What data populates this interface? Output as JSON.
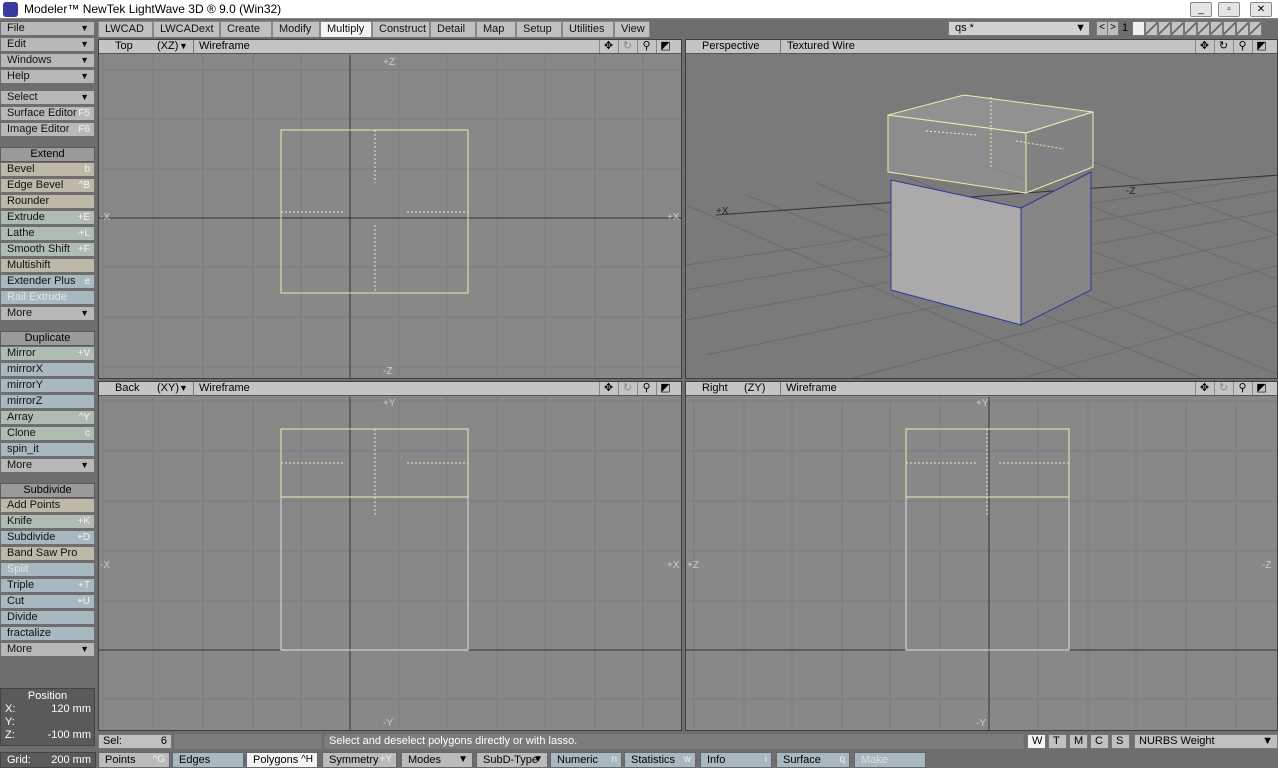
{
  "window": {
    "title": "Modeler™ NewTek LightWave 3D ® 9.0 (Win32)"
  },
  "menu_tabs": [
    "LWCAD",
    "LWCADext",
    "Create",
    "Modify",
    "Multiply",
    "Construct",
    "Detail",
    "Map",
    "Setup",
    "Utilities",
    "View"
  ],
  "active_tab": "Multiply",
  "quick_select": {
    "value": "qs *"
  },
  "layer_page": "1",
  "sidebar": {
    "top": [
      {
        "label": "File"
      },
      {
        "label": "Edit"
      },
      {
        "label": "Windows"
      },
      {
        "label": "Help"
      }
    ],
    "select": {
      "label": "Select"
    },
    "surface_editor": {
      "label": "Surface Editor",
      "key": "F5"
    },
    "image_editor": {
      "label": "Image Editor",
      "key": "F6"
    },
    "extend": {
      "header": "Extend",
      "items": [
        {
          "label": "Bevel",
          "key": "b"
        },
        {
          "label": "Edge Bevel",
          "key": "^B"
        },
        {
          "label": "Rounder",
          "key": ""
        },
        {
          "label": "Extrude",
          "key": "+E"
        },
        {
          "label": "Lathe",
          "key": "+L"
        },
        {
          "label": "Smooth Shift",
          "key": "+F"
        },
        {
          "label": "Multishift",
          "key": ""
        },
        {
          "label": "Extender Plus",
          "key": "e"
        },
        {
          "label": "Rail Extrude",
          "key": ""
        },
        {
          "label": "More",
          "key": ""
        }
      ]
    },
    "duplicate": {
      "header": "Duplicate",
      "items": [
        {
          "label": "Mirror",
          "key": "+V"
        },
        {
          "label": "mirrorX",
          "key": ""
        },
        {
          "label": "mirrorY",
          "key": ""
        },
        {
          "label": "mirrorZ",
          "key": ""
        },
        {
          "label": "Array",
          "key": "^Y"
        },
        {
          "label": "Clone",
          "key": "c"
        },
        {
          "label": "spin_it",
          "key": ""
        },
        {
          "label": "More",
          "key": ""
        }
      ]
    },
    "subdivide": {
      "header": "Subdivide",
      "items": [
        {
          "label": "Add Points",
          "key": ""
        },
        {
          "label": "Knife",
          "key": "+K"
        },
        {
          "label": "Subdivide",
          "key": "+D"
        },
        {
          "label": "Band Saw Pro",
          "key": ""
        },
        {
          "label": "Split",
          "key": ""
        },
        {
          "label": "Triple",
          "key": "+T"
        },
        {
          "label": "Cut",
          "key": "+U"
        },
        {
          "label": "Divide",
          "key": ""
        },
        {
          "label": "fractalize",
          "key": ""
        },
        {
          "label": "More",
          "key": ""
        }
      ]
    },
    "position": {
      "title": "Position",
      "x": "120 mm",
      "y": "",
      "z": "-100 mm",
      "x_lbl": "X:",
      "y_lbl": "Y:",
      "z_lbl": "Z:"
    }
  },
  "viewports": {
    "top": {
      "view": "Top",
      "axes": "(XZ)",
      "mode": "Wireframe",
      "labels": {
        "top": "+Z",
        "bottom": "-Z",
        "left": "-X",
        "right": "+X"
      }
    },
    "perspective": {
      "view": "Perspective",
      "mode": "Textured Wire",
      "labels": {
        "x": "+X",
        "z": "-Z"
      }
    },
    "back": {
      "view": "Back",
      "axes": "(XY)",
      "mode": "Wireframe",
      "labels": {
        "top": "+Y",
        "bottom": "-Y",
        "left": "-X",
        "right": "+X"
      }
    },
    "right": {
      "view": "Right",
      "axes": "(ZY)",
      "mode": "Wireframe",
      "labels": {
        "top": "+Y",
        "bottom": "-Y",
        "left": "+Z",
        "right": "-Z"
      }
    }
  },
  "status": {
    "sel_label": "Sel:",
    "sel_count": "6",
    "message": "Select and deselect polygons directly or with lasso.",
    "wtmcs": [
      "W",
      "T",
      "M",
      "C",
      "S"
    ],
    "vmap": "NURBS Weight"
  },
  "bottom": {
    "grid_label": "Grid:",
    "grid_value": "200 mm",
    "buttons": [
      {
        "label": "Points",
        "key": "^G"
      },
      {
        "label": "Edges",
        "key": ""
      },
      {
        "label": "Polygons",
        "key": "^H"
      },
      {
        "label": "Symmetry",
        "key": "+Y"
      },
      {
        "label": "Modes",
        "key": ""
      },
      {
        "label": "SubD-Type",
        "key": ""
      },
      {
        "label": "Numeric",
        "key": "n"
      },
      {
        "label": "Statistics",
        "key": "w"
      },
      {
        "label": "Info",
        "key": "i"
      },
      {
        "label": "Surface",
        "key": "q"
      },
      {
        "label": "Make",
        "key": ""
      }
    ]
  }
}
